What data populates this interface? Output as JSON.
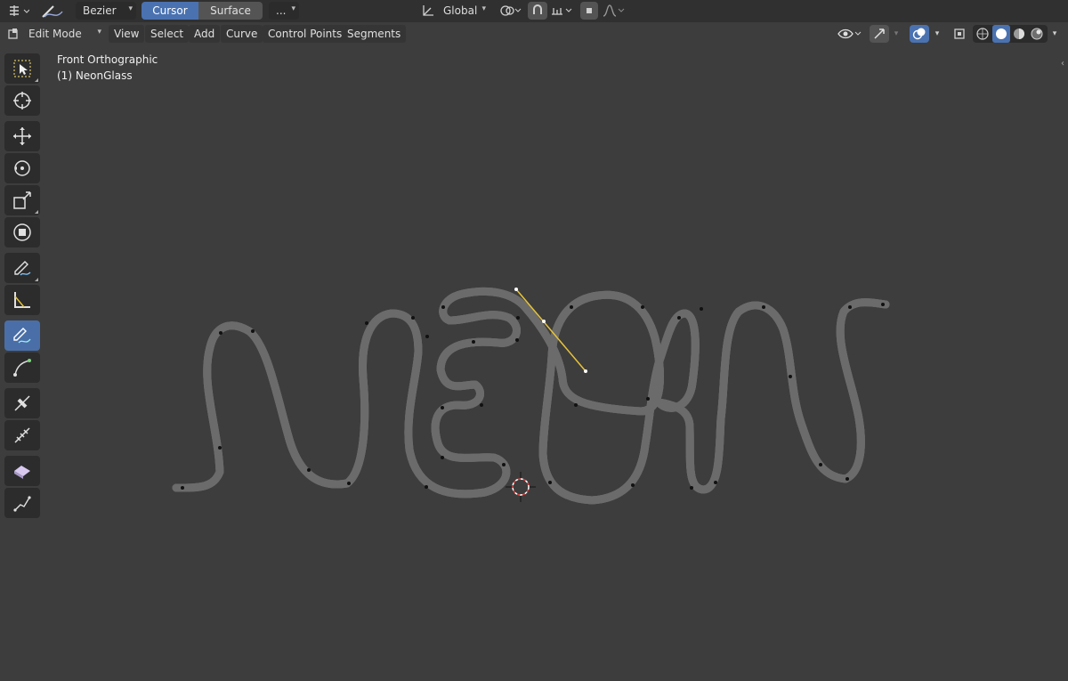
{
  "tool_settings": {
    "curve_type": "Bezier",
    "placement_options": [
      "Cursor",
      "Surface"
    ],
    "placement_active": "Cursor",
    "more_label": "...",
    "transform_orientation": "Global"
  },
  "header": {
    "mode": "Edit Mode",
    "menus": [
      "View",
      "Select",
      "Add",
      "Curve",
      "Control Points",
      "Segments"
    ]
  },
  "viewport": {
    "view_name": "Front Orthographic",
    "object_name": "(1) NeonGlass"
  },
  "left_toolbar": {
    "tools": [
      "select-box",
      "cursor",
      "move",
      "rotate",
      "scale",
      "transform",
      "annotate",
      "measure",
      "draw",
      "pen",
      "tilt",
      "radius",
      "randomize",
      "extrude",
      "smooth"
    ],
    "active": "draw"
  },
  "colors": {
    "background": "#3d3d3d",
    "header": "#303030",
    "active_blue": "#4a6fa8",
    "curve": "#a8a8a8",
    "handle": "#e8c43a"
  }
}
